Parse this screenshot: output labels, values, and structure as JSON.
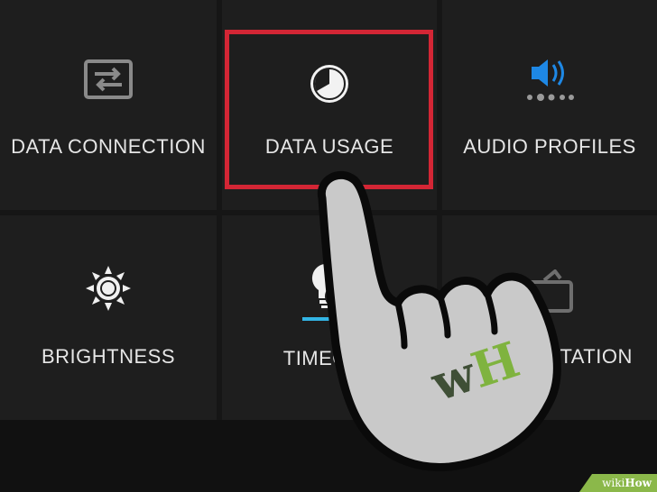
{
  "tiles": [
    {
      "label": "DATA CONNECTION",
      "icon": "data-connection-icon"
    },
    {
      "label": "DATA USAGE",
      "icon": "data-usage-icon"
    },
    {
      "label": "AUDIO PROFILES",
      "icon": "audio-profiles-icon"
    },
    {
      "label": "BRIGHTNESS",
      "icon": "brightness-icon"
    },
    {
      "label": "TIMEOUT",
      "icon": "timeout-icon"
    },
    {
      "label": "AUTO ROTATION",
      "icon": "auto-rotation-icon"
    }
  ],
  "highlight_color": "#d32635",
  "audio_accent": "#1e88e5",
  "timeout_accent": "#33b5e5",
  "watermark": {
    "prefix": "wiki",
    "suffix": "How"
  },
  "logo": {
    "w": "w",
    "h": "H"
  }
}
